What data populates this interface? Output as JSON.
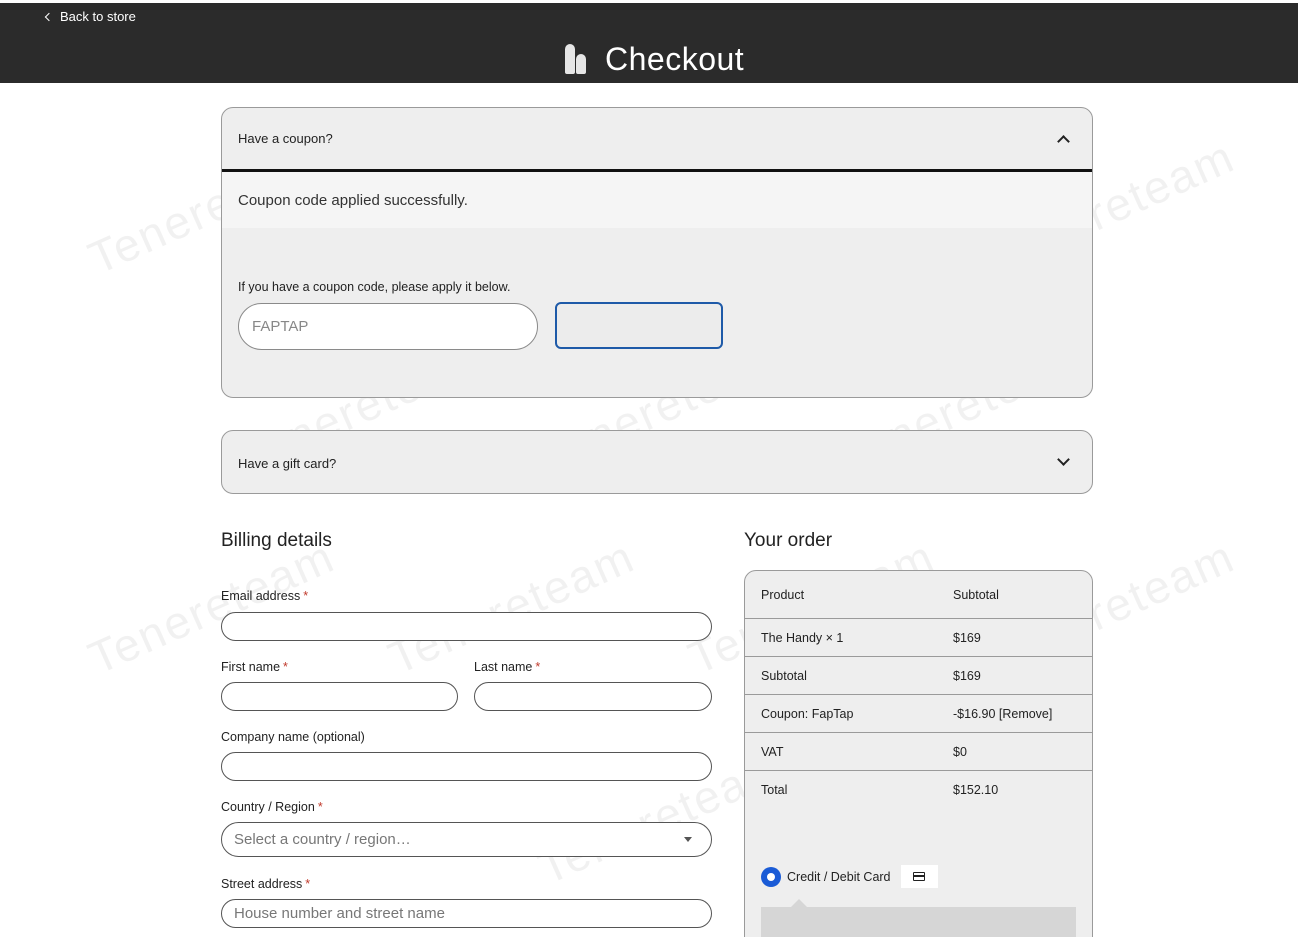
{
  "header": {
    "back_link": "Back to store",
    "title": "Checkout",
    "background_color": "#2b2b2b"
  },
  "coupon": {
    "toggle_label": "Have a coupon?",
    "success_message": "Coupon code applied successfully.",
    "hint": "If you have a coupon code, please apply it below.",
    "code_value": "FAPTAP",
    "apply_button_accent": "#1e5aa8"
  },
  "gift_card": {
    "toggle_label": "Have a gift card?"
  },
  "billing": {
    "title": "Billing details",
    "required_mark": "*",
    "email_label": "Email address",
    "first_name_label": "First name",
    "last_name_label": "Last name",
    "company_label": "Company name (optional)",
    "country_label": "Country / Region",
    "country_placeholder": "Select a country / region…",
    "street_label": "Street address",
    "street_placeholder": "House number and street name"
  },
  "order": {
    "title": "Your order",
    "header": {
      "product": "Product",
      "subtotal": "Subtotal"
    },
    "item": {
      "name": "The Handy  × 1",
      "price": "$169"
    },
    "subtotal": {
      "label": "Subtotal",
      "value": "$169"
    },
    "coupon": {
      "label": "Coupon: FapTap",
      "value": "-$16.90 [Remove]"
    },
    "vat": {
      "label": "VAT",
      "value": "$0"
    },
    "total": {
      "label": "Total",
      "value": "$152.10"
    }
  },
  "payment": {
    "method_label": "Credit / Debit Card",
    "method_icon": "credit-card-icon",
    "selected": true,
    "accent_color": "#1a5bd6"
  },
  "watermark": {
    "text": "Tenereteam"
  }
}
